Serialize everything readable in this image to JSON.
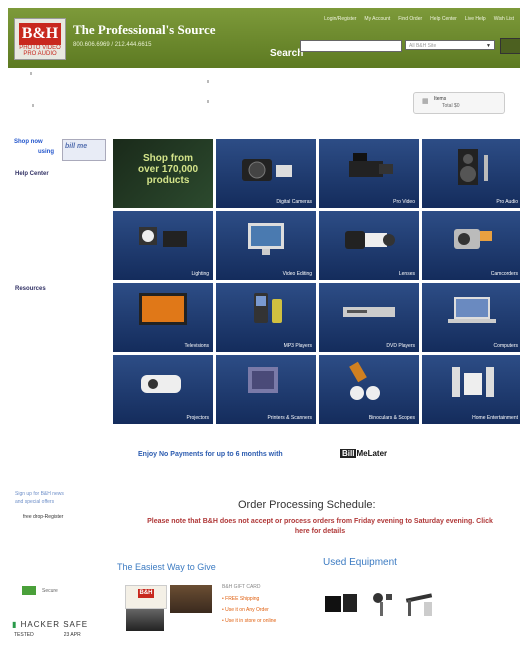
{
  "header": {
    "logo_text": "B&H",
    "logo_tagline": "PHOTO VIDEO PRO AUDIO",
    "brand_name": "The Professional's Source",
    "phone_line": "800.606.6969 / 212.444.6615",
    "top_links": [
      "Login/Register",
      "My Account",
      "Find Order",
      "Help Center",
      "Live Help",
      "Wish List"
    ],
    "search_label": "Search",
    "search_placeholder": "",
    "search_scope": "All B&H Site",
    "search_button": "Go"
  },
  "cart": {
    "line1": "Items",
    "line2": "Total $0"
  },
  "sidebar": {
    "shop_now_1": "Shop now",
    "shop_now_2": "using",
    "shop_logo": "bill me",
    "help_center_title": "Help Center",
    "resources_title": "Resources"
  },
  "categories": [
    {
      "label": "Shop from over 170,000 products",
      "promo": true
    },
    {
      "label": "Digital Cameras"
    },
    {
      "label": "Pro Video"
    },
    {
      "label": "Pro Audio"
    },
    {
      "label": "Lighting"
    },
    {
      "label": "Video Editing"
    },
    {
      "label": "Lenses"
    },
    {
      "label": "Camcorders"
    },
    {
      "label": "Televisions"
    },
    {
      "label": "MP3 Players"
    },
    {
      "label": "DVD Players"
    },
    {
      "label": "Computers"
    },
    {
      "label": "Projectors"
    },
    {
      "label": "Printers & Scanners"
    },
    {
      "label": "Binoculars & Scopes"
    },
    {
      "label": "Home Entertainment"
    }
  ],
  "promo": {
    "enjoy_text": "Enjoy No Payments for up to 6 months with",
    "billme_prefix": "Bill",
    "billme_suffix": "MeLater"
  },
  "signup": {
    "line1": "Sign up for B&H news",
    "line2": "and special offers",
    "free_product": "free drop-Register"
  },
  "order": {
    "heading": "Order Processing Schedule:",
    "body": "Please note that B&H does not accept or process orders from Friday evening to Saturday evening.",
    "link": "Click here for details"
  },
  "gift": {
    "heading": "The Easiest Way to Give",
    "title": "B&H GIFT CARD",
    "bullets": [
      "FREE Shipping",
      "Use it on Any Order",
      "Use it in store or online"
    ]
  },
  "used": {
    "heading": "Used Equipment"
  },
  "trust": {
    "badge_label": "Secure",
    "hacker_safe": "HACKER SAFE",
    "tested_label": "TESTED",
    "tested_date": "23 APR"
  },
  "colors": {
    "header_green": "#6f8c30",
    "tile_blue": "#1e3a72",
    "link_blue": "#3c7bc2",
    "order_red": "#b03838"
  }
}
